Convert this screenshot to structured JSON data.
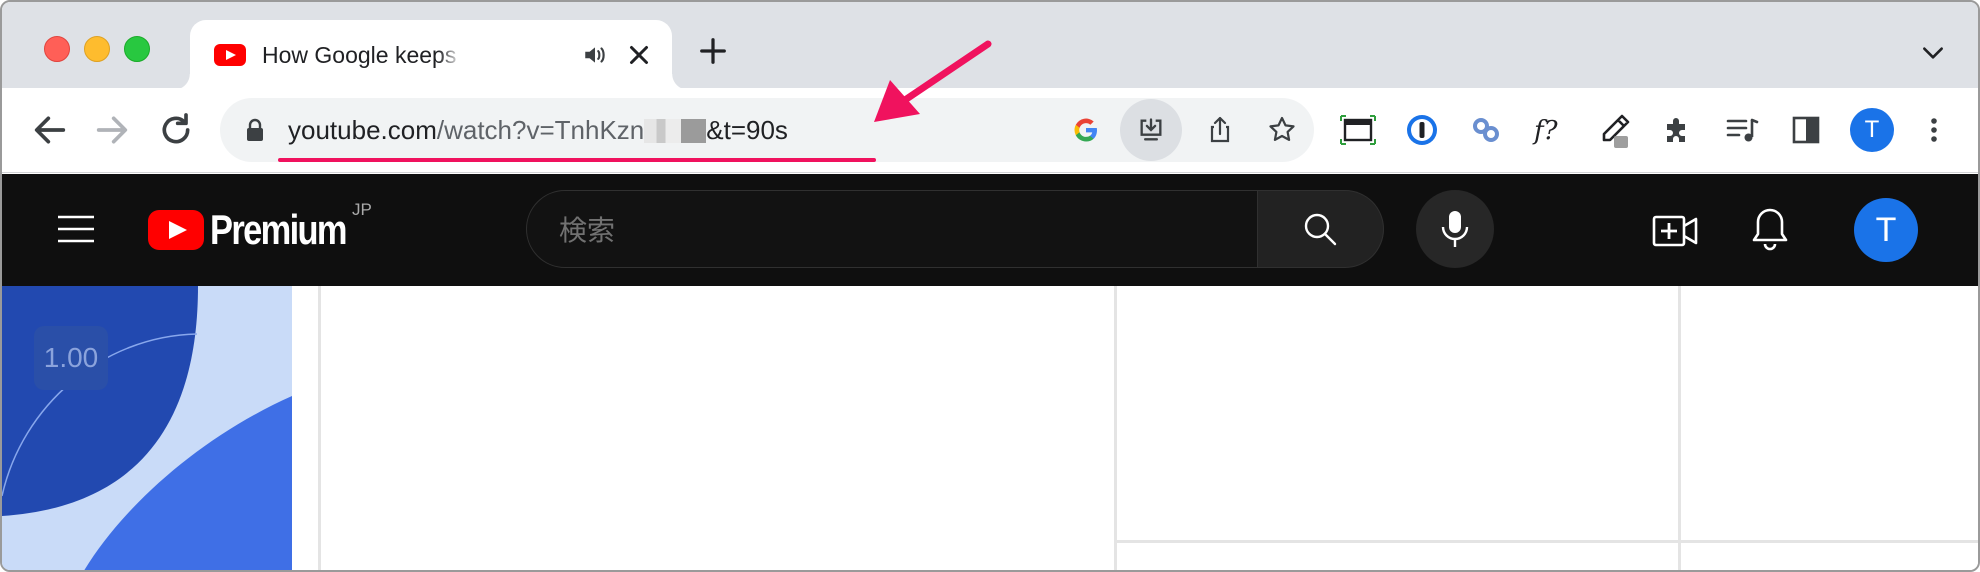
{
  "window": {
    "tab": {
      "title": "How Google keeps you safe",
      "favicon": "youtube-favicon",
      "audio_icon": "speaker-icon"
    },
    "icons": {
      "new_tab": "plus-icon",
      "tab_search": "chevron-down-icon"
    }
  },
  "toolbar": {
    "nav": [
      "back-icon",
      "forward-icon",
      "reload-icon"
    ],
    "url": {
      "host": "youtube.com",
      "path": "/watch?v=TnhKzn",
      "suffix": "&t=90s"
    },
    "omnibox_icons": [
      "google-icon",
      "install-app-icon",
      "share-icon",
      "bookmark-star-icon"
    ],
    "extensions": [
      "screenshot-icon",
      "1password-icon",
      "link-icon",
      "formula-icon",
      "eyedropper-icon",
      "puzzle-icon",
      "media-queue-icon",
      "side-panel-icon"
    ],
    "profile_initial": "T"
  },
  "youtube": {
    "brand": "Premium",
    "region": "JP",
    "search_placeholder": "検索",
    "avatar_initial": "T"
  },
  "content": {
    "thumbnail_badge": "1.00"
  },
  "colors": {
    "youtube_red": "#ff0000",
    "annotation": "#f0125e",
    "avatar_blue": "#1a73e8"
  }
}
